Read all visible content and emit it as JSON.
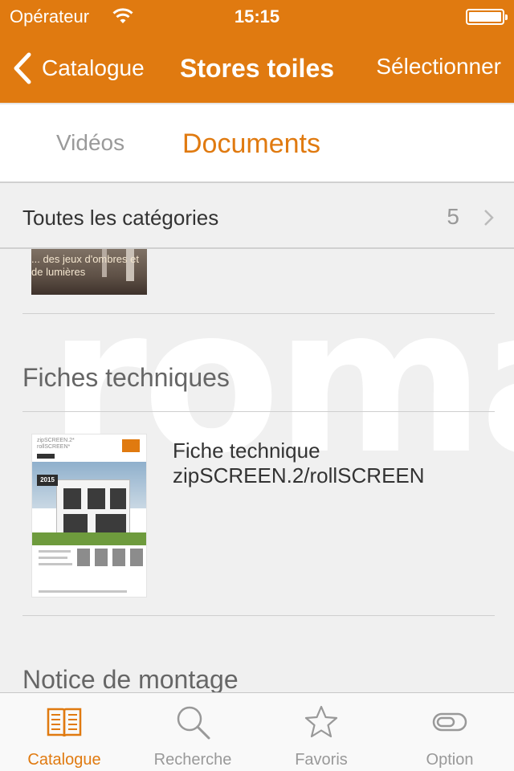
{
  "status_bar": {
    "carrier": "Opérateur",
    "time": "15:15"
  },
  "nav": {
    "back_label": "Catalogue",
    "title": "Stores toiles",
    "select_label": "Sélectionner"
  },
  "segments": [
    {
      "label": "Vidéos",
      "active": false
    },
    {
      "label": "Documents",
      "active": true
    }
  ],
  "category": {
    "label": "Toutes les catégories",
    "count": "5"
  },
  "content": {
    "watermark": "roma",
    "cut_item_caption": "... des jeux d'ombres et de lumières",
    "sections": [
      {
        "title": "Fiches techniques",
        "items": [
          {
            "title_line1": "Fiche technique",
            "title_line2": "zipSCREEN.2/rollSCREEN"
          }
        ]
      },
      {
        "title": "Notice de montage"
      }
    ]
  },
  "tabbar": [
    {
      "label": "Catalogue",
      "icon": "book-icon",
      "active": true
    },
    {
      "label": "Recherche",
      "icon": "search-icon",
      "active": false
    },
    {
      "label": "Favoris",
      "icon": "star-icon",
      "active": false
    },
    {
      "label": "Option",
      "icon": "toggle-icon",
      "active": false
    }
  ],
  "colors": {
    "accent": "#e07a10",
    "inactive": "#999999",
    "background": "#f0f0f0"
  }
}
